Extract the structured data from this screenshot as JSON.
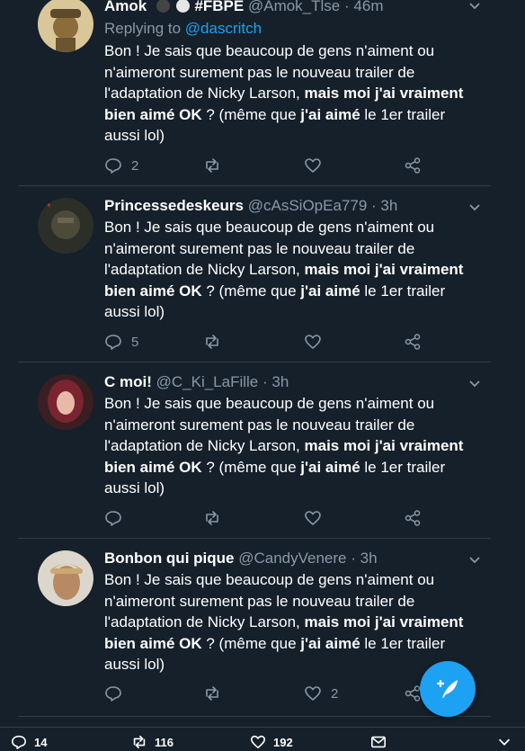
{
  "tweets": [
    {
      "name": "Amok",
      "handle": "@Amok_Tlse",
      "time": "46m",
      "badge": "#FBPE",
      "reply_prefix": "Replying to",
      "reply_to": "@dascritch",
      "text_1": "Bon ! Je sais que beaucoup de gens n'aiment ou n'aimeront surement pas le nouveau trailer de l'adaptation de Nicky Larson, ",
      "bold_1": "mais moi j'ai vraiment bien aimé OK",
      "text_2": " ?  (même que ",
      "bold_2": "j'ai aimé",
      "text_3": " le 1er trailer aussi lol)",
      "replies": "2",
      "retweets": "",
      "likes": ""
    },
    {
      "name": "Princessedeskeurs",
      "handle": "@cAsSiOpEa779",
      "time": "3h",
      "text_1": "Bon ! Je sais que beaucoup de gens n'aiment ou n'aimeront surement pas le nouveau trailer de l'adaptation de Nicky Larson, ",
      "bold_1": "mais moi j'ai vraiment bien aimé OK",
      "text_2": " ?  (même que ",
      "bold_2": "j'ai aimé",
      "text_3": " le 1er trailer aussi lol)",
      "replies": "5",
      "retweets": "",
      "likes": ""
    },
    {
      "name": "C moi!",
      "handle": "@C_Ki_LaFille",
      "time": "3h",
      "text_1": "Bon ! Je sais que beaucoup de gens n'aiment ou n'aimeront surement pas le nouveau trailer de l'adaptation de Nicky Larson, ",
      "bold_1": "mais moi j'ai vraiment bien aimé OK",
      "text_2": " ?  (même que ",
      "bold_2": "j'ai aimé",
      "text_3": " le 1er trailer aussi lol)",
      "replies": "",
      "retweets": "",
      "likes": ""
    },
    {
      "name": "Bonbon qui pique",
      "handle": "@CandyVenere",
      "time": "3h",
      "text_1": "Bon ! Je sais que beaucoup de gens n'aiment ou n'aimeront surement pas le nouveau trailer de l'adaptation de Nicky Larson, ",
      "bold_1": "mais moi j'ai vraiment bien aimé OK",
      "text_2": " ?  (même que ",
      "bold_2": "j'ai aimé",
      "text_3": " le 1er trailer aussi lol)",
      "replies": "",
      "retweets": "",
      "likes": "2"
    }
  ],
  "separator": "·",
  "bottom_bar": {
    "replies": "14",
    "retweets": "116",
    "likes": "192"
  },
  "icons": {
    "reply": "reply-icon",
    "retweet": "retweet-icon",
    "like": "heart-icon",
    "share": "share-icon",
    "menu": "chevron-down-icon",
    "compose": "compose-icon",
    "message": "envelope-icon"
  },
  "colors": {
    "background": "#15202b",
    "accent": "#1da1f2",
    "muted": "#8899a6",
    "divider": "#2f3d4a"
  }
}
